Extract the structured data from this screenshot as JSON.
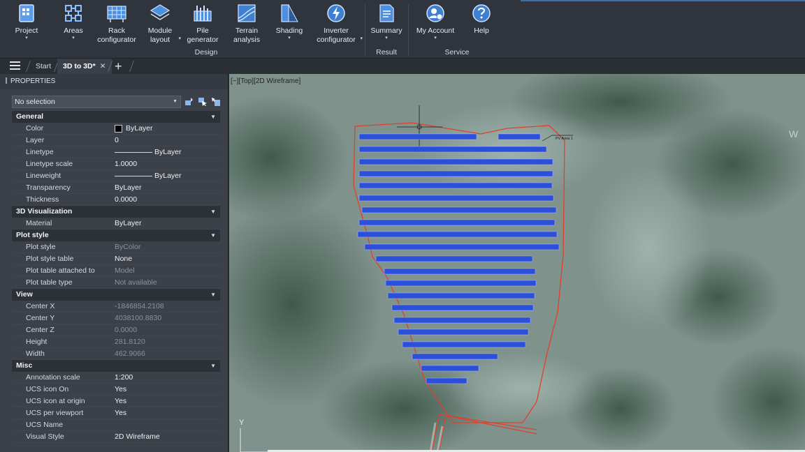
{
  "ribbon": {
    "buttons": [
      {
        "label": "Project",
        "caret": "▾"
      },
      {
        "label": "Areas",
        "caret": "▾"
      },
      {
        "label": "Rack\nconfigurator"
      },
      {
        "label": "Module\nlayout",
        "caret": "▾"
      },
      {
        "label": "Pile\ngenerator"
      },
      {
        "label": "Terrain\nanalysis"
      },
      {
        "label": "Shading",
        "caret": "▾"
      },
      {
        "label": "Inverter\nconfigurator",
        "caret": "▾"
      },
      {
        "label": "Summary",
        "caret": "▾"
      },
      {
        "label": "My Account",
        "caret": "▾"
      },
      {
        "label": "Help"
      }
    ],
    "groups": {
      "design": "Design",
      "result": "Result",
      "service": "Service"
    }
  },
  "tabs": {
    "start": "Start",
    "active": "3D to 3D*",
    "close": "✕",
    "add": "+"
  },
  "properties": {
    "title": "PROPERTIES",
    "selection": "No selection",
    "sections": [
      {
        "name": "General",
        "rows": [
          {
            "k": "Color",
            "v": "ByLayer",
            "type": "swatch"
          },
          {
            "k": "Layer",
            "v": "0"
          },
          {
            "k": "Linetype",
            "v": "ByLayer",
            "type": "line"
          },
          {
            "k": "Linetype scale",
            "v": "1.0000"
          },
          {
            "k": "Lineweight",
            "v": "ByLayer",
            "type": "line"
          },
          {
            "k": "Transparency",
            "v": "ByLayer"
          },
          {
            "k": "Thickness",
            "v": "0.0000"
          }
        ]
      },
      {
        "name": "3D Visualization",
        "rows": [
          {
            "k": "Material",
            "v": "ByLayer"
          }
        ]
      },
      {
        "name": "Plot style",
        "rows": [
          {
            "k": "Plot style",
            "v": "ByColor",
            "dim": true
          },
          {
            "k": "Plot style table",
            "v": "None"
          },
          {
            "k": "Plot table attached to",
            "v": "Model",
            "dim": true
          },
          {
            "k": "Plot table type",
            "v": "Not available",
            "dim": true
          }
        ]
      },
      {
        "name": "View",
        "rows": [
          {
            "k": "Center X",
            "v": "-1846854.2108",
            "dim": true
          },
          {
            "k": "Center Y",
            "v": "4038100.8830",
            "dim": true
          },
          {
            "k": "Center Z",
            "v": "0.0000",
            "dim": true
          },
          {
            "k": "Height",
            "v": "281.8120",
            "dim": true
          },
          {
            "k": "Width",
            "v": "462.9066",
            "dim": true
          }
        ]
      },
      {
        "name": "Misc",
        "rows": [
          {
            "k": "Annotation scale",
            "v": "1:200"
          },
          {
            "k": "UCS icon On",
            "v": "Yes"
          },
          {
            "k": "UCS icon at origin",
            "v": "Yes"
          },
          {
            "k": "UCS per viewport",
            "v": "Yes"
          },
          {
            "k": "UCS Name",
            "v": ""
          },
          {
            "k": "Visual Style",
            "v": "2D Wireframe"
          }
        ]
      }
    ]
  },
  "viewport": {
    "label": "[−][Top][2D Wireframe]",
    "area_label": "PV Area 1",
    "axis_label": "Y",
    "edge_letter": "W"
  },
  "colors": {
    "accent": "#3d6fa8",
    "boundary": "#e0402a",
    "panels": "#2b4fd8"
  }
}
